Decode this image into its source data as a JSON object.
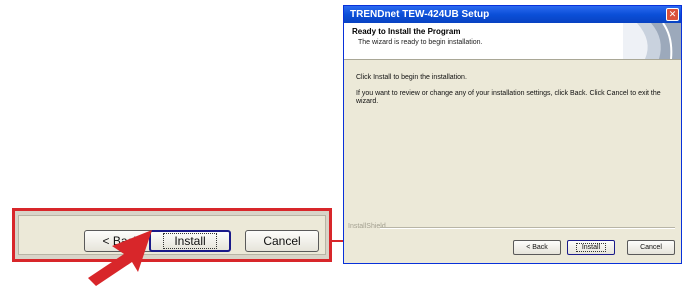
{
  "zoom": {
    "back_label": "< Back",
    "install_label": "Install",
    "cancel_label": "Cancel"
  },
  "dialog": {
    "title": "TRENDnet TEW-424UB Setup",
    "close_label": "✕",
    "header_title": "Ready to Install the Program",
    "header_subtitle": "The wizard is ready to begin installation.",
    "instruction": "Click Install to begin the installation.",
    "review_text": "If you want to review or change any of your installation settings, click Back. Click Cancel to exit the wizard.",
    "separator_label": "InstallShield",
    "back_label": "< Back",
    "install_label": "Install",
    "cancel_label": "Cancel"
  },
  "colors": {
    "highlight": "#d8262a",
    "titlebar": "#0b4fd8",
    "dialog_bg": "#ece9d8"
  }
}
